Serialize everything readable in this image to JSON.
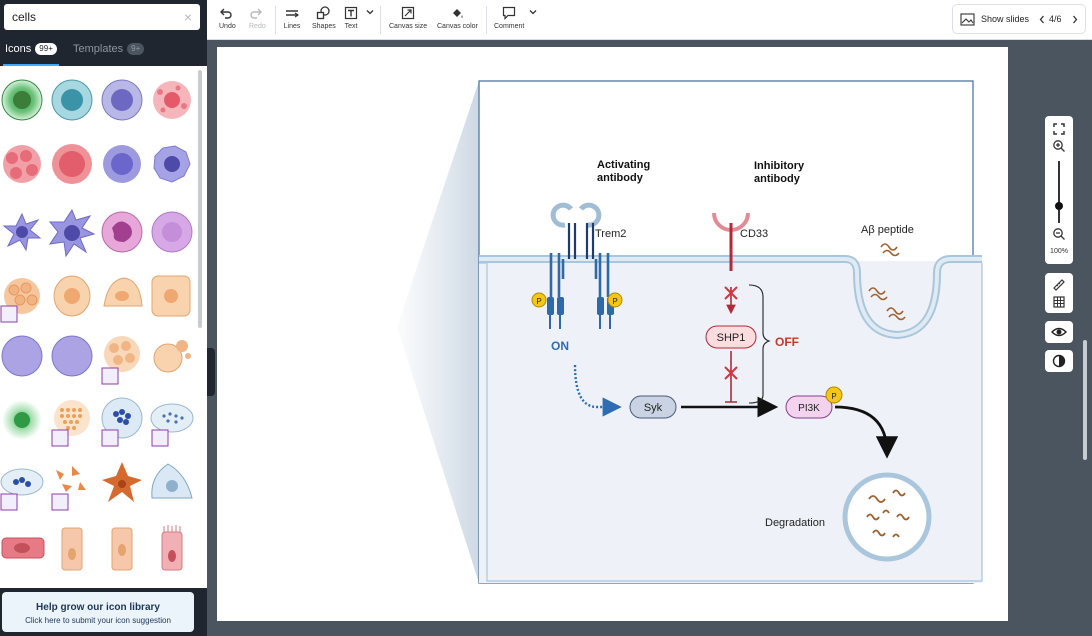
{
  "search": {
    "value": "cells",
    "clear_icon": "×"
  },
  "panel_tabs": [
    {
      "label": "Icons",
      "count": "99+"
    },
    {
      "label": "Templates",
      "count": "9+"
    }
  ],
  "help": {
    "title": "Help grow our icon library",
    "subtitle": "Click here to submit your icon suggestion"
  },
  "toolbar": {
    "undo": "Undo",
    "redo": "Redo",
    "lines": "Lines",
    "shapes": "Shapes",
    "text": "Text",
    "canvas_size": "Canvas size",
    "canvas_color": "Canvas color",
    "comment": "Comment",
    "show_slides": "Show slides",
    "page_indicator": "4/6"
  },
  "figure": {
    "activating_antibody": [
      "Activating",
      "antibody"
    ],
    "inhibitory_antibody": [
      "Inhibitory",
      "antibody"
    ],
    "trem2": "Trem2",
    "cd33": "CD33",
    "abeta": "Aβ peptide",
    "p": "P",
    "on": "ON",
    "off": "OFF",
    "shp1": "SHP1",
    "syk": "Syk",
    "pi3k": "PI3K",
    "degradation": "Degradation"
  },
  "zoom": {
    "percent": "100%"
  },
  "colors": {
    "accent_blue": "#3fa9ff",
    "off_red": "#c0392b",
    "on_blue": "#2e6db4",
    "membrane": "#a9c6dc"
  }
}
